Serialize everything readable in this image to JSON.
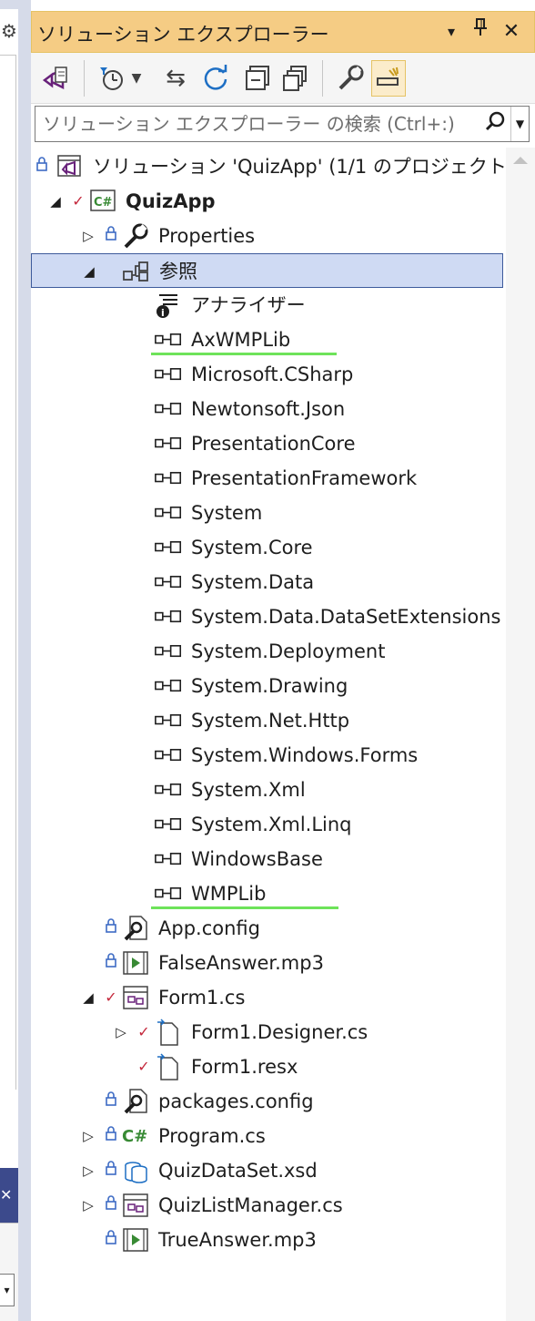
{
  "window": {
    "title": "ソリューション エクスプローラー",
    "title_buttons": [
      "▾",
      "🖈",
      "✕"
    ]
  },
  "search": {
    "placeholder": "ソリューション エクスプローラー の検索 (Ctrl+:)"
  },
  "tree": [
    {
      "label": "ソリューション 'QuizApp' (1/1 のプロジェクト)",
      "icon": "solution-icon",
      "lock": true
    },
    {
      "label": "QuizApp",
      "icon": "csharp-project-icon",
      "expanded": true,
      "check": true,
      "bold": true
    },
    {
      "label": "Properties",
      "icon": "wrench-icon",
      "collapsed": true,
      "lock": true
    },
    {
      "label": "参照",
      "icon": "references-icon",
      "expanded": true,
      "selected": true
    },
    {
      "label": "アナライザー",
      "icon": "analyzer-icon"
    },
    {
      "label": "AxWMPLib",
      "icon": "reference-icon",
      "underlined": true
    },
    {
      "label": "Microsoft.CSharp",
      "icon": "reference-icon"
    },
    {
      "label": "Newtonsoft.Json",
      "icon": "reference-icon"
    },
    {
      "label": "PresentationCore",
      "icon": "reference-icon"
    },
    {
      "label": "PresentationFramework",
      "icon": "reference-icon"
    },
    {
      "label": "System",
      "icon": "reference-icon"
    },
    {
      "label": "System.Core",
      "icon": "reference-icon"
    },
    {
      "label": "System.Data",
      "icon": "reference-icon"
    },
    {
      "label": "System.Data.DataSetExtensions",
      "icon": "reference-icon"
    },
    {
      "label": "System.Deployment",
      "icon": "reference-icon"
    },
    {
      "label": "System.Drawing",
      "icon": "reference-icon"
    },
    {
      "label": "System.Net.Http",
      "icon": "reference-icon"
    },
    {
      "label": "System.Windows.Forms",
      "icon": "reference-icon"
    },
    {
      "label": "System.Xml",
      "icon": "reference-icon"
    },
    {
      "label": "System.Xml.Linq",
      "icon": "reference-icon"
    },
    {
      "label": "WindowsBase",
      "icon": "reference-icon"
    },
    {
      "label": "WMPLib",
      "icon": "reference-icon",
      "underlined": true
    },
    {
      "label": "App.config",
      "icon": "config-icon",
      "lock": true
    },
    {
      "label": "FalseAnswer.mp3",
      "icon": "media-icon",
      "lock": true
    },
    {
      "label": "Form1.cs",
      "icon": "form-icon",
      "expanded": true,
      "check": true
    },
    {
      "label": "Form1.Designer.cs",
      "icon": "file-icon",
      "collapsed": true,
      "check": true
    },
    {
      "label": "Form1.resx",
      "icon": "file-icon",
      "check": true
    },
    {
      "label": "packages.config",
      "icon": "config-icon",
      "lock": true
    },
    {
      "label": "Program.cs",
      "icon": "csharp-file-icon",
      "collapsed": true,
      "lock": true
    },
    {
      "label": "QuizDataSet.xsd",
      "icon": "dataset-icon",
      "collapsed": true,
      "lock": true
    },
    {
      "label": "QuizListManager.cs",
      "icon": "form-icon",
      "collapsed": true,
      "lock": true
    },
    {
      "label": "TrueAnswer.mp3",
      "icon": "media-icon",
      "lock": true
    }
  ],
  "colors": {
    "title_bar": "#f5cc84",
    "selection": "#cfdaf3",
    "underline": "#6ee35a",
    "check": "#c4283c",
    "lock": "#3d6bc4"
  }
}
